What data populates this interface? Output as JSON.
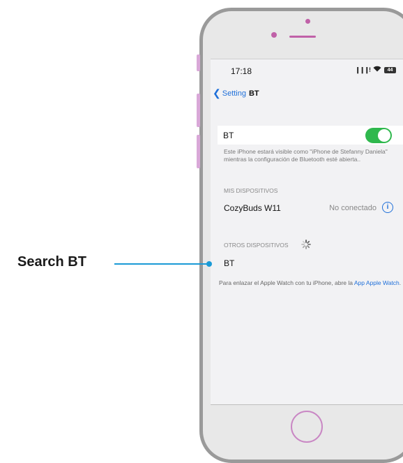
{
  "status_bar": {
    "time": "17:18",
    "signal": "❙❙❙!",
    "wifi": "◉",
    "battery": "44"
  },
  "nav": {
    "back_label": "Setting",
    "title": "BT"
  },
  "bt": {
    "label": "BT",
    "toggle_on": true,
    "toggle_color": "#2fb84d"
  },
  "visibility_note": "Este iPhone estará visible como \"iPhone de Stefanny Daniela\" mientras la configuración de Bluetooth esté abierta..",
  "my_devices": {
    "header": "MIS DISPOSITIVOS",
    "items": [
      {
        "name": "CozyBuds W11",
        "status": "No conectado"
      }
    ]
  },
  "other_devices": {
    "header": "OTROS DISPOSITIVOS",
    "items": [
      {
        "name": "BT"
      }
    ]
  },
  "footer": {
    "text": "Para enlazar el Apple Watch con tu iPhone, abre la ",
    "link": "App Apple Watch",
    "suffix": "."
  },
  "callout": {
    "label": "Search BT",
    "color": "#1a9ad6"
  }
}
